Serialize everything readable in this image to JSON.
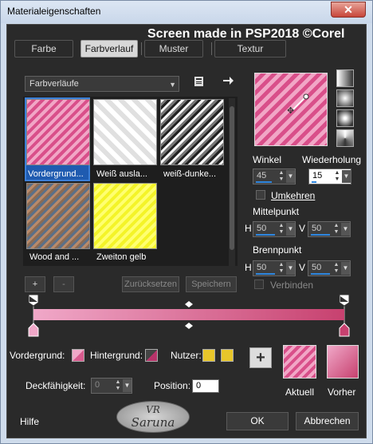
{
  "window": {
    "title": "Materialeigenschaften",
    "close_label": "✕"
  },
  "watermark": "Screen made in PSP2018 ©Corel",
  "tabs": [
    {
      "label": "Farbe",
      "active": false
    },
    {
      "label": "Farbverlauf",
      "active": true
    },
    {
      "label": "Muster",
      "active": false
    },
    {
      "label": "Textur",
      "active": false
    }
  ],
  "category": {
    "selected": "Farbverläufe"
  },
  "gradients": [
    {
      "label": "Vordergrund...",
      "selected": true
    },
    {
      "label": "Weiß ausla...",
      "selected": false
    },
    {
      "label": "weiß-dunke...",
      "selected": false
    },
    {
      "label": "Wood and ...",
      "selected": false
    },
    {
      "label": "Zweiton gelb",
      "selected": false
    }
  ],
  "library_buttons": {
    "add": "+",
    "remove": "-",
    "reset": "Zurücksetzen",
    "save": "Speichern"
  },
  "angle": {
    "label": "Winkel",
    "value": "45"
  },
  "repeat": {
    "label": "Wiederholung",
    "value": "15"
  },
  "invert": {
    "label": "Umkehren",
    "checked": false
  },
  "center": {
    "label": "Mittelpunkt",
    "h_label": "H",
    "h_value": "50",
    "v_label": "V",
    "v_value": "50"
  },
  "focal": {
    "label": "Brennpunkt",
    "h_label": "H",
    "h_value": "50",
    "v_label": "V",
    "v_value": "50"
  },
  "link": {
    "label": "Verbinden",
    "checked": false
  },
  "colors": {
    "foreground": "#d95c8f",
    "background": "#b8336a",
    "user": "#e8c62a",
    "accent": "#2e86de",
    "gradient_start": "#f0a8c8",
    "gradient_end": "#c7416f"
  },
  "stops": {
    "foreground_label": "Vordergrund:",
    "background_label": "Hintergrund:",
    "user_label": "Nutzer:",
    "opacity_label": "Deckfähigkeit:",
    "opacity_value": "0",
    "position_label": "Position:",
    "position_value": "0"
  },
  "add_stop": "+",
  "current_label": "Aktuell",
  "previous_label": "Vorher",
  "footer": {
    "help": "Hilfe",
    "ok": "OK",
    "cancel": "Abbrechen",
    "logo_line1": "VR",
    "logo_line2": "Saruna"
  }
}
